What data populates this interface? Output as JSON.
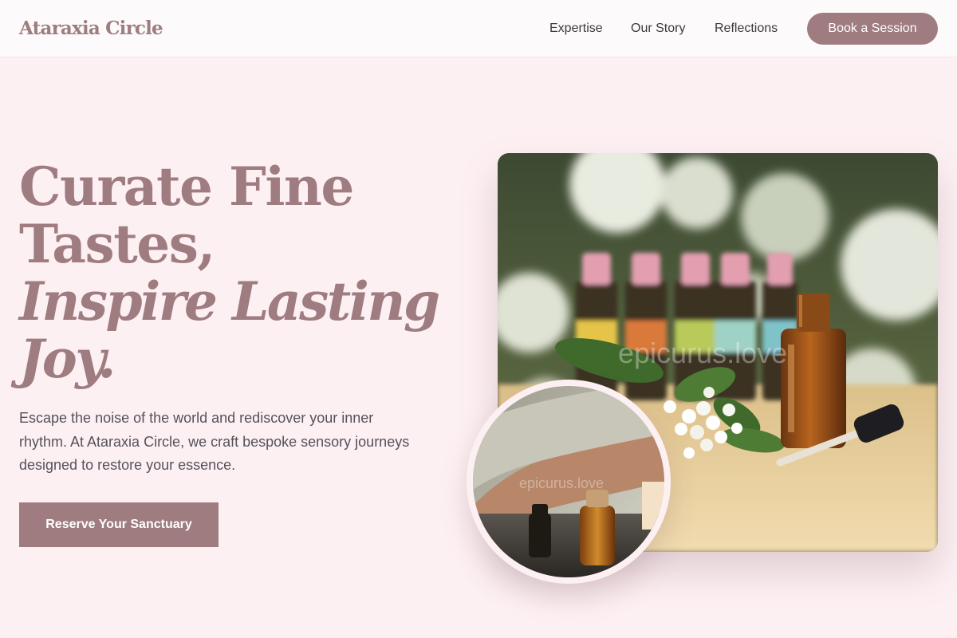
{
  "header": {
    "logo": "Ataraxia Circle",
    "nav": [
      "Expertise",
      "Our Story",
      "Reflections"
    ],
    "cta": "Book a Session"
  },
  "hero": {
    "title_lines": [
      "Curate Fine",
      "Tastes,",
      "Inspire Lasting",
      "Joy."
    ],
    "description": "Escape the noise of the world and rediscover your inner rhythm. At Ataraxia Circle, we craft bespoke sensory journeys designed to restore your essence.",
    "cta": "Reserve Your Sanctuary"
  },
  "images": {
    "main_watermark": "epicurus.love",
    "circle_watermark": "epicurus.love"
  },
  "colors": {
    "accent": "#9e7c80",
    "background": "#fdf0f3",
    "header_bg": "#fcfafa",
    "text": "#3d3a3f"
  }
}
